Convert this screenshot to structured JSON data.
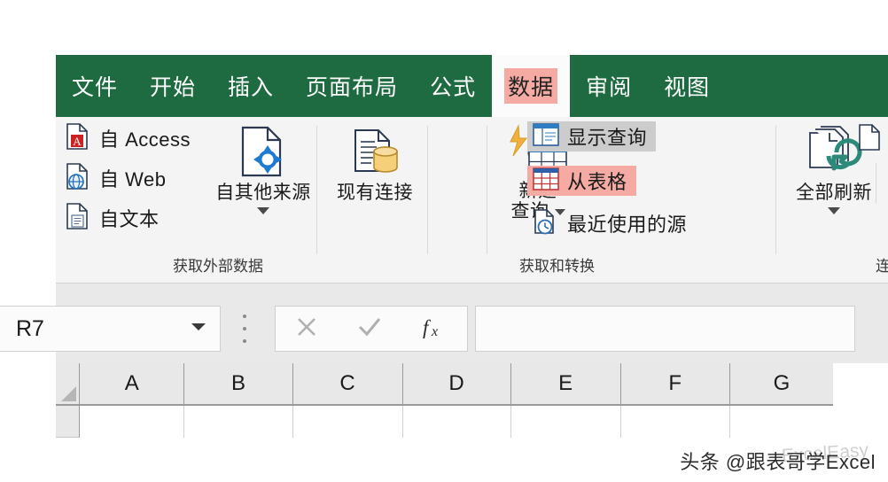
{
  "app": {
    "ribbon_green": "#1e6b41",
    "highlight_pink": "#f5aaa4",
    "hover_gray": "#cccccc"
  },
  "tabs": [
    {
      "label": "文件",
      "name": "tab-file",
      "active": false,
      "highlighted": false
    },
    {
      "label": "开始",
      "name": "tab-home",
      "active": false,
      "highlighted": false
    },
    {
      "label": "插入",
      "name": "tab-insert",
      "active": false,
      "highlighted": false
    },
    {
      "label": "页面布局",
      "name": "tab-page-layout",
      "active": false,
      "highlighted": false
    },
    {
      "label": "公式",
      "name": "tab-formulas",
      "active": false,
      "highlighted": false
    },
    {
      "label": "数据",
      "name": "tab-data",
      "active": true,
      "highlighted": true
    },
    {
      "label": "审阅",
      "name": "tab-review",
      "active": false,
      "highlighted": false
    },
    {
      "label": "视图",
      "name": "tab-view",
      "active": false,
      "highlighted": false
    }
  ],
  "ribbon": {
    "groups": [
      {
        "label": "获取外部数据"
      },
      {
        "label": "获取和转换"
      },
      {
        "label": "连"
      }
    ],
    "get_external_data": {
      "small_buttons": [
        {
          "label": "自 Access",
          "icon": "access-file-icon"
        },
        {
          "label": "自 Web",
          "icon": "web-file-icon"
        },
        {
          "label": "自文本",
          "icon": "text-file-icon"
        }
      ],
      "from_other_sources": {
        "label": "自其他来源",
        "icon": "other-sources-icon",
        "has_dropdown": true
      },
      "existing_connections": {
        "label": "现有连接",
        "icon": "existing-connection-icon",
        "has_dropdown": false
      }
    },
    "get_and_transform": {
      "new_query": {
        "label_line1": "新建",
        "label_line2": "查询",
        "icon": "new-query-icon",
        "has_dropdown": true
      },
      "items": [
        {
          "label": "显示查询",
          "icon": "show-queries-icon",
          "state": "hover"
        },
        {
          "label": "从表格",
          "icon": "from-table-icon",
          "state": "highlighted"
        },
        {
          "label": "最近使用的源",
          "icon": "recent-sources-icon",
          "state": "normal"
        }
      ]
    },
    "connections": {
      "refresh_all": {
        "label": "全部刷新",
        "icon": "refresh-all-icon",
        "has_dropdown": true
      }
    }
  },
  "formula_bar": {
    "name_box_value": "R7",
    "cancel_icon": "cancel-x-icon",
    "confirm_icon": "confirm-check-icon",
    "function_icon": "fx-icon",
    "input_value": ""
  },
  "grid": {
    "columns": [
      "A",
      "B",
      "C",
      "D",
      "E",
      "F",
      "G"
    ],
    "row_label": "",
    "select_all_icon": "select-all-corner-icon"
  },
  "watermark": {
    "main": "头条 @跟表哥学Excel",
    "ghost": "ExcelEasy"
  }
}
